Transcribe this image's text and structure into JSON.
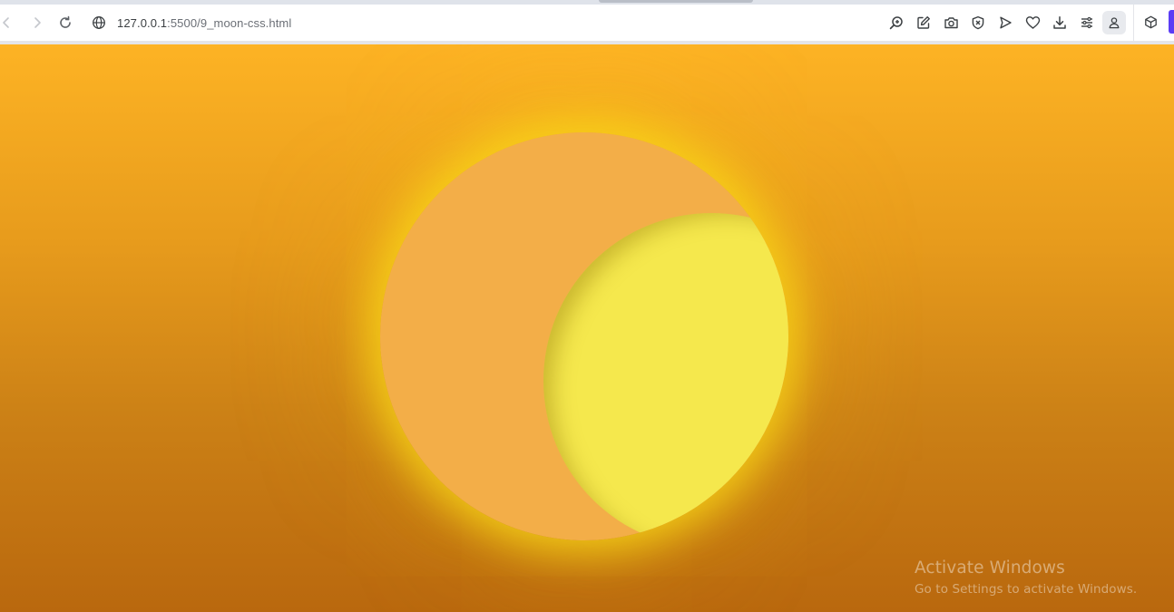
{
  "browser": {
    "url_host": "127.0.0.1",
    "url_path": ":5500/9_moon-css.html",
    "nav": {
      "back": "back-icon",
      "forward": "forward-icon",
      "reload": "reload-icon"
    },
    "address_icon": "globe-icon",
    "tools": [
      "zoom-icon",
      "edit-icon",
      "camera-icon",
      "shield-icon",
      "send-icon",
      "heart-icon",
      "download-icon",
      "menu-icon",
      "profile-icon"
    ],
    "extension_icon": "cube-icon",
    "accent": "#5b3df5"
  },
  "scene": {
    "sky_top": "#fdb324",
    "sky_bottom": "#b9680e",
    "moon_color": "#f3ae48",
    "crescent_color": "#f5e84d",
    "glow_color": "#f8d618"
  },
  "watermark": {
    "title": "Activate Windows",
    "subtitle": "Go to Settings to activate Windows."
  }
}
